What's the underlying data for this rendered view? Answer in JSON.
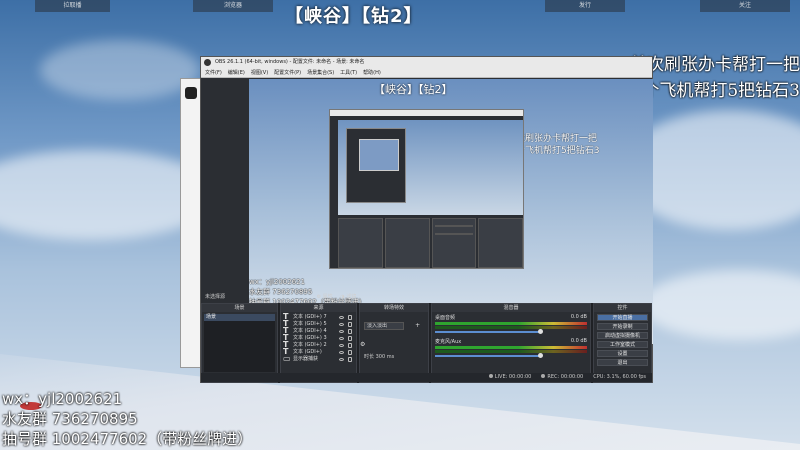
{
  "hud": {
    "left_button": "拉取播",
    "left2_button": "浏览器",
    "right1_button": "发行",
    "right2_button": "关注"
  },
  "overlay": {
    "title": "【峡谷】【钻2】",
    "right_line1": "首次刷张办卡帮打一把",
    "right_line2": "一个飞机帮打5把钻石3",
    "left_line1": "wx：yjl2002621",
    "left_line2": "水友群 736270895",
    "left_line3": "抽号群 1002477602（带粉丝牌进）"
  },
  "obs": {
    "window_title": "OBS 26.1.1 (64-bit, windows) - 配置文件: 未命名 - 场景: 未命名",
    "menu": [
      "文件(F)",
      "编辑(E)",
      "视图(V)",
      "配置文件(P)",
      "场景集合(S)",
      "工具(T)",
      "帮助(H)"
    ],
    "preview_title": "【峡谷】【钻2】",
    "preview_right1": "首次刷张办卡帮打一把",
    "preview_right2": "一个飞机帮打5把钻石3",
    "preview_left1": "wx：yjl2002621",
    "preview_left2": "水友群 736270895",
    "preview_left3": "抽号群 1002477602（带粉丝牌进）",
    "no_source_label": "未选择源",
    "props_label": "属性",
    "filters_label": "滤镜",
    "docks": {
      "scenes_header": "场景",
      "sources_header": "来源",
      "transitions_header": "转场特效",
      "mixer_header": "混音器",
      "controls_header": "控件"
    },
    "scenes": [
      "场景"
    ],
    "sources": [
      "文本 (GDI+) 7",
      "文本 (GDI+) 5",
      "文本 (GDI+) 4",
      "文本 (GDI+) 3",
      "文本 (GDI+) 2",
      "文本 (GDI+)",
      "显示器捕获"
    ],
    "transition": {
      "selected": "淡入淡出",
      "duration_label": "时长",
      "duration_value": "300 ms"
    },
    "mixer": [
      {
        "name": "桌面音频",
        "db": "0.0 dB"
      },
      {
        "name": "麦克风/Aux",
        "db": "0.0 dB"
      }
    ],
    "controls": [
      "开始直播",
      "开始录制",
      "启动虚拟摄像机",
      "工作室模式",
      "设置",
      "退出"
    ],
    "status": {
      "live": "LIVE: 00:00:00",
      "rec": "REC: 00:00:00",
      "cpu": "CPU: 3.1%, 60.00 fps"
    }
  }
}
